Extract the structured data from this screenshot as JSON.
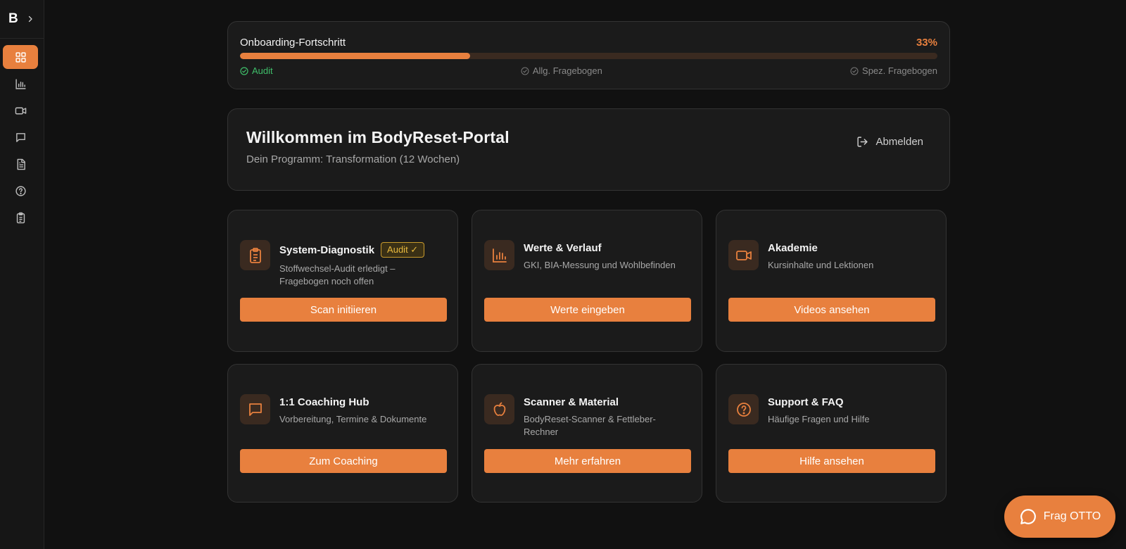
{
  "sidebar": {
    "logo": "B",
    "items": [
      {
        "name": "dashboard",
        "icon": "grid-icon",
        "active": true
      },
      {
        "name": "values",
        "icon": "bar-chart-icon",
        "active": false
      },
      {
        "name": "academy",
        "icon": "video-icon",
        "active": false
      },
      {
        "name": "coaching",
        "icon": "chat-icon",
        "active": false
      },
      {
        "name": "documents",
        "icon": "document-icon",
        "active": false
      },
      {
        "name": "support",
        "icon": "help-icon",
        "active": false
      },
      {
        "name": "questionnaire",
        "icon": "clipboard-icon",
        "active": false
      }
    ]
  },
  "progress": {
    "title": "Onboarding-Fortschritt",
    "percent_label": "33%",
    "percent": 33,
    "steps": [
      {
        "label": "Audit",
        "done": true
      },
      {
        "label": "Allg. Fragebogen",
        "done": false
      },
      {
        "label": "Spez. Fragebogen",
        "done": false
      }
    ]
  },
  "welcome": {
    "title": "Willkommen im BodyReset-Portal",
    "subtitle": "Dein Programm: Transformation (12 Wochen)",
    "logout_label": "Abmelden"
  },
  "features": [
    {
      "title": "System-Diagnostik",
      "badge": "Audit ✓",
      "desc": "Stoffwechsel-Audit erledigt – Fragebogen noch offen",
      "button": "Scan initiieren",
      "icon": "clipboard-icon"
    },
    {
      "title": "Werte & Verlauf",
      "desc": "GKI, BIA-Messung und Wohlbefinden",
      "button": "Werte eingeben",
      "icon": "bar-chart-icon"
    },
    {
      "title": "Akademie",
      "desc": "Kursinhalte und Lektionen",
      "button": "Videos ansehen",
      "icon": "video-icon"
    },
    {
      "title": "1:1 Coaching Hub",
      "desc": "Vorbereitung, Termine & Dokumente",
      "button": "Zum Coaching",
      "icon": "chat-icon"
    },
    {
      "title": "Scanner & Material",
      "desc": "BodyReset-Scanner & Fettleber-Rechner",
      "button": "Mehr erfahren",
      "icon": "apple-icon"
    },
    {
      "title": "Support & FAQ",
      "desc": "Häufige Fragen und Hilfe",
      "button": "Hilfe ansehen",
      "icon": "help-icon"
    }
  ],
  "chat": {
    "label": "Frag OTTO",
    "icon": "chat-bubble-icon"
  },
  "colors": {
    "accent": "#e8803e",
    "success": "#3fbf6a",
    "badge": "#e8b93e",
    "background": "#111111",
    "card": "#1b1b1b"
  }
}
